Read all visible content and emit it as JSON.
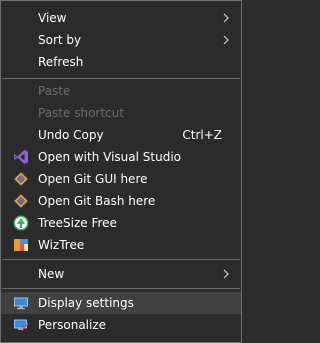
{
  "menu": {
    "view": {
      "label": "View",
      "icon": "chevron-right-icon"
    },
    "sort_by": {
      "label": "Sort by",
      "icon": "chevron-right-icon"
    },
    "refresh": {
      "label": "Refresh"
    },
    "paste": {
      "label": "Paste",
      "enabled": false
    },
    "paste_shortcut": {
      "label": "Paste shortcut",
      "enabled": false
    },
    "undo_copy": {
      "label": "Undo Copy",
      "shortcut": "Ctrl+Z"
    },
    "open_visual_studio": {
      "label": "Open with Visual Studio",
      "icon": "visual-studio-icon"
    },
    "open_git_gui": {
      "label": "Open Git GUI here",
      "icon": "git-icon"
    },
    "open_git_bash": {
      "label": "Open Git Bash here",
      "icon": "git-icon"
    },
    "treesize": {
      "label": "TreeSize Free",
      "icon": "treesize-icon"
    },
    "wiztree": {
      "label": "WizTree",
      "icon": "wiztree-icon"
    },
    "new": {
      "label": "New",
      "icon": "chevron-right-icon"
    },
    "display_settings": {
      "label": "Display settings",
      "icon": "monitor-icon",
      "highlighted": true
    },
    "personalize": {
      "label": "Personalize",
      "icon": "personalize-icon"
    }
  },
  "colors": {
    "background": "#2b2b2b",
    "text": "#ffffff",
    "disabled_text": "#6d6d6d",
    "highlight": "#414141",
    "separator": "#6a6a6a",
    "border": "#6f6f6f"
  }
}
